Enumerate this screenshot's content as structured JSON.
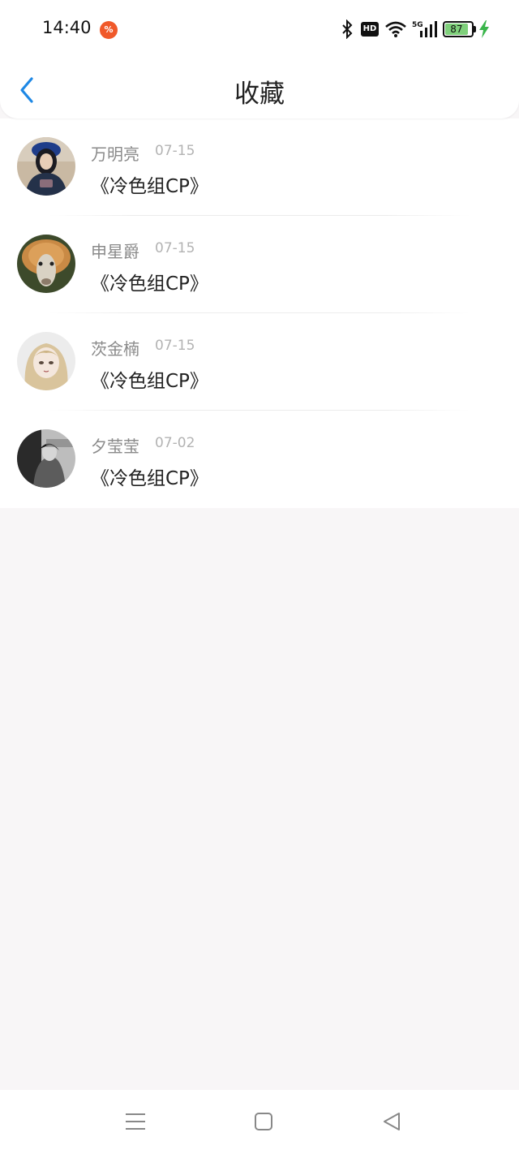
{
  "status_bar": {
    "time": "14:40",
    "badge": "%",
    "hd": "HD",
    "network": "5G",
    "battery": "87",
    "battery_level": 0.87
  },
  "header": {
    "title": "收藏"
  },
  "favorites": [
    {
      "name": "万明亮",
      "date": "07-15",
      "title": "《冷色组CP》"
    },
    {
      "name": "申星爵",
      "date": "07-15",
      "title": "《冷色组CP》"
    },
    {
      "name": "茨金楠",
      "date": "07-15",
      "title": "《冷色组CP》"
    },
    {
      "name": "夕莹莹",
      "date": "07-02",
      "title": "《冷色组CP》"
    }
  ],
  "colors": {
    "accent": "#1e88e5",
    "background": "#f8f6f7"
  }
}
